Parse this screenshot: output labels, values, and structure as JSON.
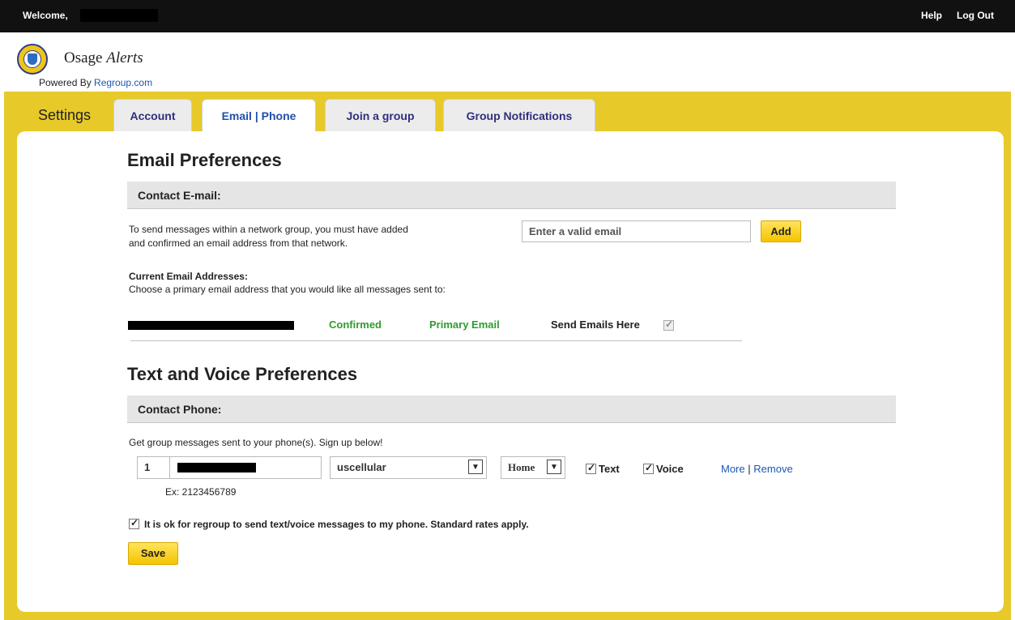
{
  "topbar": {
    "welcome": "Welcome,",
    "help": "Help",
    "logout": "Log Out"
  },
  "brand": {
    "name_prefix": "Osage",
    "name_suffix": "Alerts",
    "powered_by": "Powered By",
    "powered_link": "Regroup.com"
  },
  "settings_label": "Settings",
  "tabs": [
    {
      "label": "Account"
    },
    {
      "label": "Email | Phone"
    },
    {
      "label": "Join a group"
    },
    {
      "label": "Group Notifications"
    }
  ],
  "email": {
    "heading": "Email Preferences",
    "section_title": "Contact E-mail:",
    "instructions_line1": "To send messages within a network group, you must have added",
    "instructions_line2": "and confirmed an email address from that network.",
    "input_placeholder": "Enter a valid email",
    "add_label": "Add",
    "current_title": "Current Email Addresses:",
    "current_desc": "Choose a primary email address that you would like all messages sent to:",
    "row": {
      "status": "Confirmed",
      "primary": "Primary Email",
      "send_here": "Send Emails Here"
    }
  },
  "phone": {
    "heading": "Text and Voice Preferences",
    "section_title": "Contact Phone:",
    "instructions": "Get group messages sent to your phone(s). Sign up below!",
    "country_code": "1",
    "carrier": "uscellular",
    "phone_type": "Home",
    "text_label": "Text",
    "voice_label": "Voice",
    "more": "More",
    "separator": "|",
    "remove": "Remove",
    "example": "Ex: 2123456789",
    "consent": "It is ok for regroup to send text/voice messages to my phone. Standard rates apply.",
    "save_label": "Save"
  },
  "colors": {
    "frame_yellow": "#e7c92a",
    "button_yellow": "#f5c400",
    "confirmed_green": "#2e9b2e",
    "link_blue": "#1a58b5",
    "tab_text": "#2f2f7f"
  }
}
